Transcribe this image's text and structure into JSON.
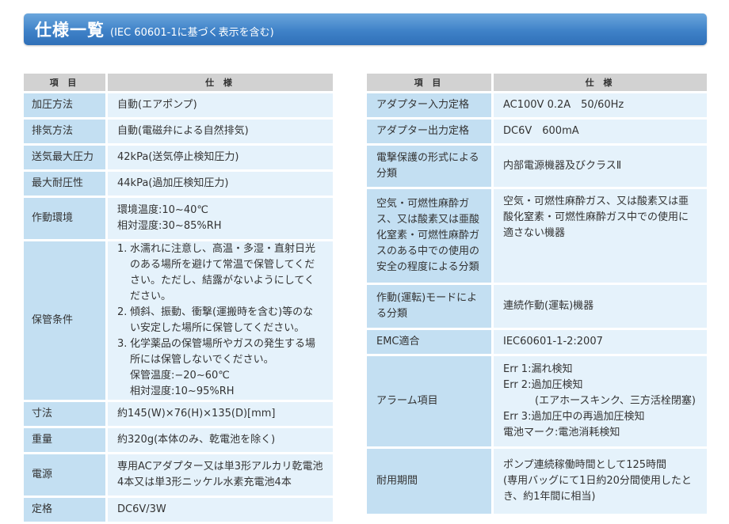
{
  "header": {
    "title": "仕様一覧",
    "subtitle": "(IEC 60601-1に基づく表示を含む)"
  },
  "left_table": {
    "col_item": "項 目",
    "col_spec": "仕 様",
    "rows": [
      {
        "item": "加圧方法",
        "lines": [
          "自動(エアポンプ)"
        ]
      },
      {
        "item": "排気方法",
        "lines": [
          "自動(電磁弁による自然排気)"
        ]
      },
      {
        "item": "送気最大圧力",
        "lines": [
          "42kPa(送気停止検知圧力)"
        ]
      },
      {
        "item": "最大耐圧性",
        "lines": [
          "44kPa(過加圧検知圧力)"
        ]
      },
      {
        "item": "作動環境",
        "lines": [
          "環境温度:10~40℃",
          "相対湿度:30~85%RH"
        ]
      },
      {
        "item": "保管条件",
        "list": [
          {
            "num": "1.",
            "text": "水濡れに注意し、高温・多湿・直射日光のある場所を避けて常温で保管してください。ただし、結露がないようにしてください。"
          },
          {
            "num": "2.",
            "text": "傾斜、振動、衝撃(運搬時を含む)等のない安定した場所に保管してください。"
          },
          {
            "num": "3.",
            "text": "化学薬品の保管場所やガスの発生する場所には保管しないでください。"
          }
        ],
        "extra": [
          "保管温度:−20~60℃",
          "相対湿度:10~95%RH"
        ]
      },
      {
        "item": "寸法",
        "lines": [
          "約145(W)×76(H)×135(D)[mm]"
        ]
      },
      {
        "item": "重量",
        "lines": [
          "約320g(本体のみ、乾電池を除く)"
        ]
      },
      {
        "item": "電源",
        "lines": [
          "専用ACアダプター又は単3形アルカリ乾電池4本又は単3形ニッケル水素充電池4本"
        ]
      },
      {
        "item": "定格",
        "lines": [
          "DC6V/3W"
        ]
      }
    ]
  },
  "right_table": {
    "col_item": "項 目",
    "col_spec": "仕 様",
    "rows": [
      {
        "item": "アダプター入力定格",
        "lines": [
          "AC100V 0.2A　50/60Hz"
        ]
      },
      {
        "item": "アダプター出力定格",
        "lines": [
          "DC6V　600mA"
        ]
      },
      {
        "item": "電撃保護の形式による分類",
        "lines": [
          "内部電源機器及びクラスⅡ"
        ]
      },
      {
        "item": "空気・可燃性麻酔ガス、又は酸素又は亜酸化窒素・可燃性麻酔ガスのある中での使用の安全の程度による分類",
        "lines": [
          "空気・可燃性麻酔ガス、又は酸素又は亜酸化窒素・可燃性麻酔ガス中での使用に適さない機器"
        ]
      },
      {
        "item": "作動(運転)モードによる分類",
        "lines": [
          "連続作動(運転)機器"
        ]
      },
      {
        "item": "EMC適合",
        "lines": [
          "IEC60601-1-2:2007"
        ]
      },
      {
        "item": "アラーム項目",
        "alarm": [
          "Err 1:漏れ検知",
          "Err 2:過加圧検知",
          "(エアホースキンク、三方活栓閉塞)",
          "Err 3:過加圧中の再過加圧検知",
          "電池マーク:電池消耗検知"
        ]
      },
      {
        "item": "耐用期間",
        "lines": [
          "ポンプ連続稼働時間として125時間",
          "(専用バッグにて1日約20分間使用したとき、約1年間に相当)"
        ]
      }
    ]
  }
}
